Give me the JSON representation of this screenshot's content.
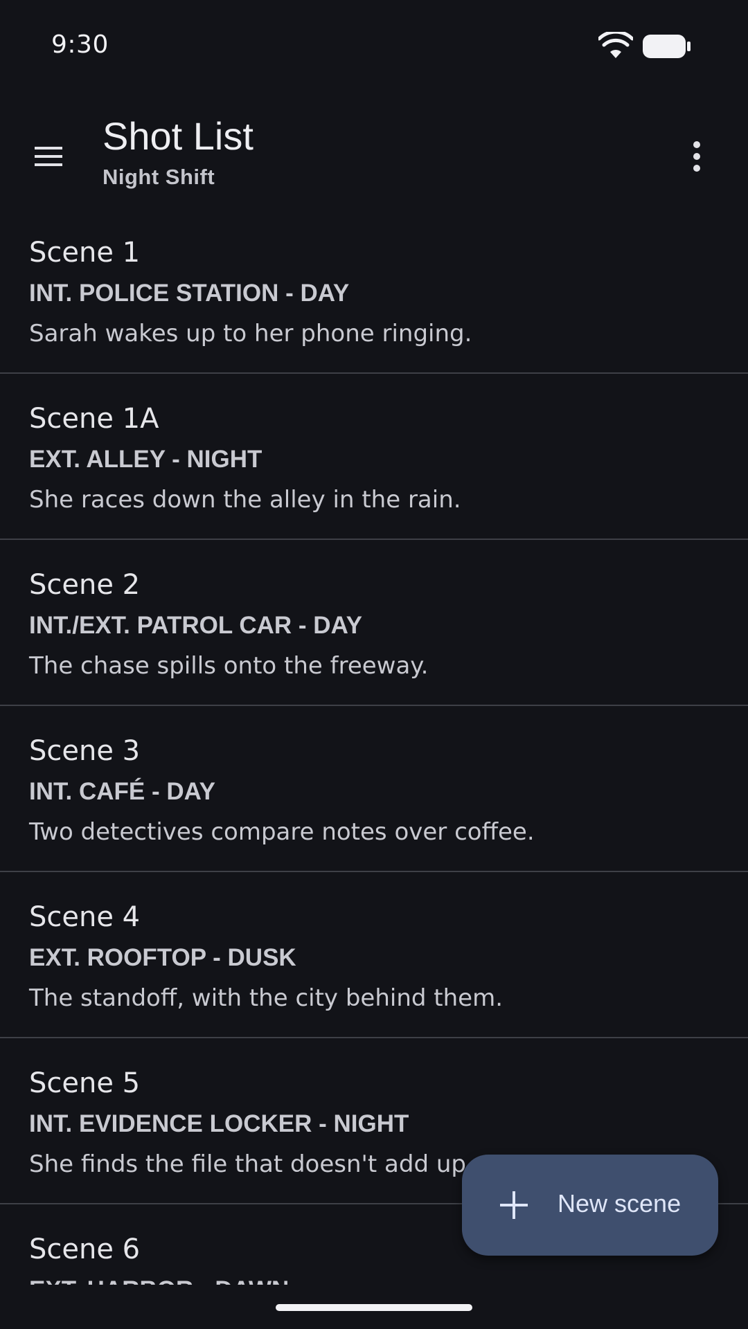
{
  "status_bar": {
    "time": "9:30",
    "icons": [
      "wifi-icon",
      "battery-icon"
    ]
  },
  "app_bar": {
    "title": "Shot List",
    "subtitle": "Night Shift",
    "icons": [
      "menu-icon",
      "more-vert-icon"
    ]
  },
  "scenes": [
    {
      "title": "Scene 1",
      "heading": "INT. POLICE STATION - DAY",
      "description": "Sarah wakes up to her phone ringing."
    },
    {
      "title": "Scene 1A",
      "heading": "EXT. ALLEY - NIGHT",
      "description": "She races down the alley in the rain."
    },
    {
      "title": "Scene 2",
      "heading": "INT./EXT. PATROL CAR - DAY",
      "description": "The chase spills onto the freeway."
    },
    {
      "title": "Scene 3",
      "heading": "INT. CAFÉ - DAY",
      "description": "Two detectives compare notes over coffee."
    },
    {
      "title": "Scene 4",
      "heading": "EXT. ROOFTOP - DUSK",
      "description": "The standoff, with the city behind them."
    },
    {
      "title": "Scene 5",
      "heading": "INT. EVIDENCE LOCKER - NIGHT",
      "description": "She finds the file that doesn't add up."
    },
    {
      "title": "Scene 6",
      "heading": "EXT. HARBOR - DAWN",
      "description": ""
    }
  ],
  "fab": {
    "label": "New scene",
    "icon": "plus-icon"
  },
  "colors": {
    "background": "#121318",
    "divider": "#3e4047",
    "fab_background": "#3f4f6e",
    "fab_text": "#dfe6f8"
  }
}
